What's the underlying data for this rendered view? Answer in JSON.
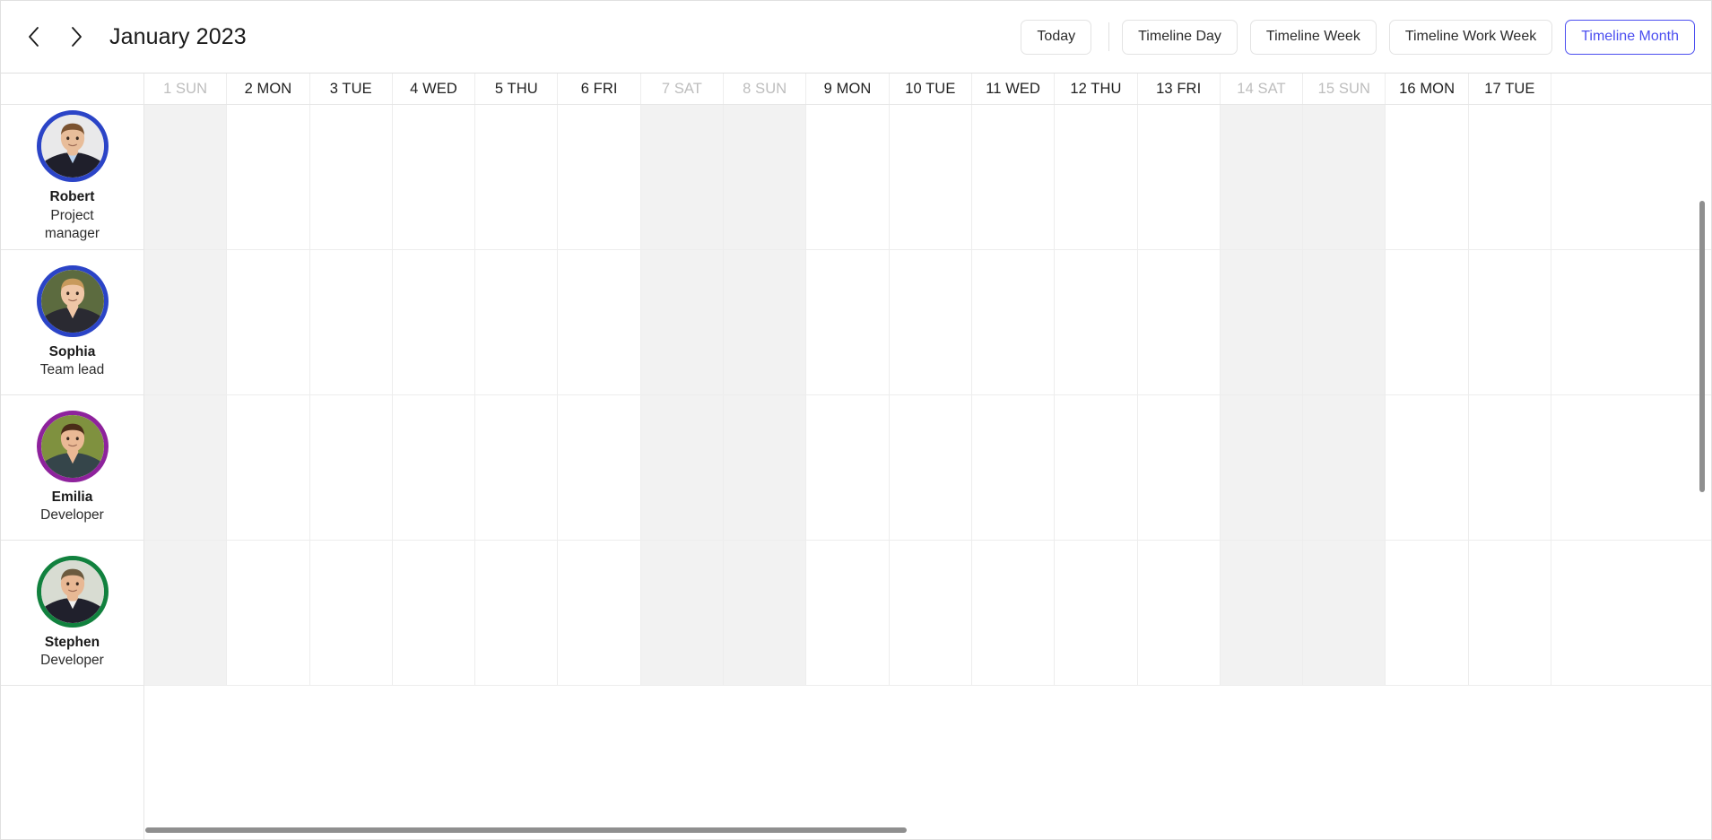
{
  "toolbar": {
    "prev_icon": "chevron-left-icon",
    "next_icon": "chevron-right-icon",
    "date_title": "January 2023",
    "today_label": "Today",
    "views": [
      {
        "label": "Timeline Day",
        "active": false
      },
      {
        "label": "Timeline Week",
        "active": false
      },
      {
        "label": "Timeline Work Week",
        "active": false
      },
      {
        "label": "Timeline Month",
        "active": true
      }
    ],
    "accent_color": "#4b4ef0"
  },
  "timeline": {
    "resource_header": "",
    "days": [
      {
        "label": "1 SUN",
        "weekend": true
      },
      {
        "label": "2 MON",
        "weekend": false
      },
      {
        "label": "3 TUE",
        "weekend": false
      },
      {
        "label": "4 WED",
        "weekend": false
      },
      {
        "label": "5 THU",
        "weekend": false
      },
      {
        "label": "6 FRI",
        "weekend": false
      },
      {
        "label": "7 SAT",
        "weekend": true
      },
      {
        "label": "8 SUN",
        "weekend": true
      },
      {
        "label": "9 MON",
        "weekend": false
      },
      {
        "label": "10 TUE",
        "weekend": false
      },
      {
        "label": "11 WED",
        "weekend": false
      },
      {
        "label": "12 THU",
        "weekend": false
      },
      {
        "label": "13 FRI",
        "weekend": false
      },
      {
        "label": "14 SAT",
        "weekend": true
      },
      {
        "label": "15 SUN",
        "weekend": true
      },
      {
        "label": "16 MON",
        "weekend": false
      },
      {
        "label": "17 TUE",
        "weekend": false
      }
    ],
    "resources": [
      {
        "name": "Robert",
        "role": "Project manager",
        "ring_color": "#2b44c7",
        "skin": "#e8bd9a",
        "hair": "#7a5230",
        "shirt": "#1f1f2b",
        "collar": "#b9d2ee",
        "bg": "#e9e9ea"
      },
      {
        "name": "Sophia",
        "role": "Team lead",
        "ring_color": "#2b44c7",
        "skin": "#efc6a6",
        "hair": "#c89a5c",
        "shirt": "#2a2a32",
        "collar": "#efc6a6",
        "bg": "#5c6b3f"
      },
      {
        "name": "Emilia",
        "role": "Developer",
        "ring_color": "#8e229c",
        "skin": "#eab995",
        "hair": "#4a2c18",
        "shirt": "#35454a",
        "collar": "#eab995",
        "bg": "#7f913f"
      },
      {
        "name": "Stephen",
        "role": "Developer",
        "ring_color": "#11813e",
        "skin": "#e8b894",
        "hair": "#6b5a3e",
        "shirt": "#20202c",
        "collar": "#f0f0f0",
        "bg": "#d8dcd2"
      }
    ],
    "events": []
  },
  "scrollbars": {
    "horizontal": "horizontal-scrollbar",
    "vertical": "vertical-scrollbar"
  }
}
